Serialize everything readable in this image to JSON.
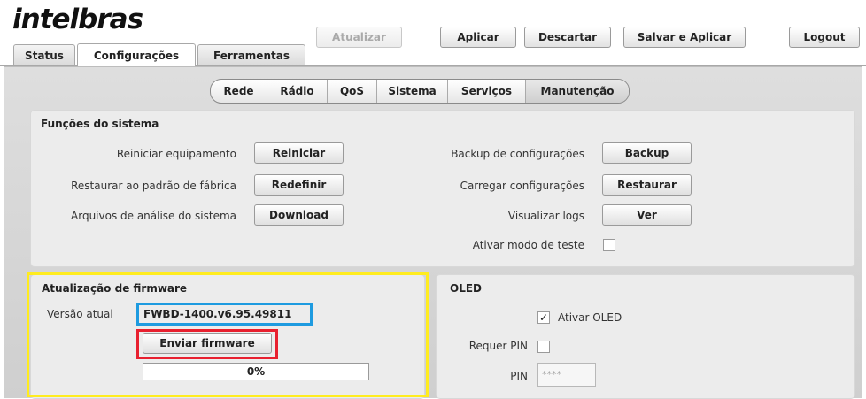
{
  "header": {
    "logo_text": "intelbras",
    "buttons": {
      "update": "Atualizar",
      "apply": "Aplicar",
      "discard": "Descartar",
      "save_apply": "Salvar e Aplicar",
      "logout": "Logout"
    }
  },
  "tabs": [
    {
      "label": "Status",
      "active": false
    },
    {
      "label": "Configurações",
      "active": true
    },
    {
      "label": "Ferramentas",
      "active": false
    }
  ],
  "subnav": [
    {
      "label": "Rede",
      "active": false
    },
    {
      "label": "Rádio",
      "active": false
    },
    {
      "label": "QoS",
      "active": false
    },
    {
      "label": "Sistema",
      "active": false
    },
    {
      "label": "Serviços",
      "active": false
    },
    {
      "label": "Manutenção",
      "active": true
    }
  ],
  "system_functions": {
    "title": "Funções do sistema",
    "left": [
      {
        "label": "Reiniciar equipamento",
        "button": "Reiniciar"
      },
      {
        "label": "Restaurar ao padrão de fábrica",
        "button": "Redefinir"
      },
      {
        "label": "Arquivos de análise do sistema",
        "button": "Download"
      }
    ],
    "right": [
      {
        "label": "Backup de configurações",
        "button": "Backup"
      },
      {
        "label": "Carregar configurações",
        "button": "Restaurar"
      },
      {
        "label": "Visualizar logs",
        "button": "Ver"
      }
    ],
    "test_mode": {
      "label": "Ativar modo de teste",
      "checked": false
    }
  },
  "firmware": {
    "title": "Atualização de firmware",
    "current_version_label": "Versão atual",
    "current_version": "FWBD-1400.v6.95.49811",
    "send_button": "Enviar firmware",
    "progress_text": "0%",
    "progress_value": 0
  },
  "oled": {
    "title": "OLED",
    "enable_label": "Ativar OLED",
    "enable_checked": true,
    "require_pin_label": "Requer PIN",
    "require_pin_checked": false,
    "pin_label": "PIN",
    "pin_value": "****"
  },
  "colors": {
    "highlight_yellow": "#ffec1f",
    "highlight_blue": "#1e9be0",
    "highlight_red": "#e8202f"
  }
}
